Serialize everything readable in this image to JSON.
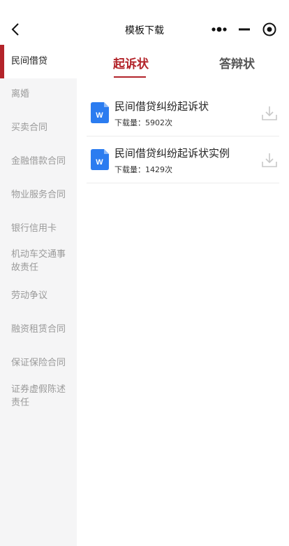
{
  "header": {
    "title": "模板下载",
    "back_icon": "chevron-left-icon",
    "capsule_icons": [
      "more-dots-icon",
      "minimize-icon",
      "close-target-icon"
    ]
  },
  "sidebar": {
    "items": [
      {
        "label": "民间借贷",
        "active": true
      },
      {
        "label": "离婚",
        "active": false
      },
      {
        "label": "买卖合同",
        "active": false
      },
      {
        "label": "金融借款合同",
        "active": false
      },
      {
        "label": "物业服务合同",
        "active": false
      },
      {
        "label": "银行信用卡",
        "active": false
      },
      {
        "label": "机动车交通事故责任",
        "active": false
      },
      {
        "label": "劳动争议",
        "active": false
      },
      {
        "label": "融资租赁合同",
        "active": false
      },
      {
        "label": "保证保险合同",
        "active": false
      },
      {
        "label": "证券虚假陈述责任",
        "active": false
      }
    ]
  },
  "tabs": [
    {
      "label": "起诉状",
      "active": true
    },
    {
      "label": "答辩状",
      "active": false
    }
  ],
  "files": [
    {
      "name": "民间借贷纠纷起诉状",
      "downloads": "下载量：5902次",
      "icon": "word-document-icon",
      "action_icon": "download-icon"
    },
    {
      "name": "民间借贷纠纷起诉状实例",
      "downloads": "下载量：1429次",
      "icon": "word-document-icon",
      "action_icon": "download-icon"
    }
  ],
  "colors": {
    "accent": "#b3242a",
    "word_blue": "#2b7cf0",
    "sidebar_bg": "#f5f5f6",
    "muted_text": "#9a9a9a"
  }
}
